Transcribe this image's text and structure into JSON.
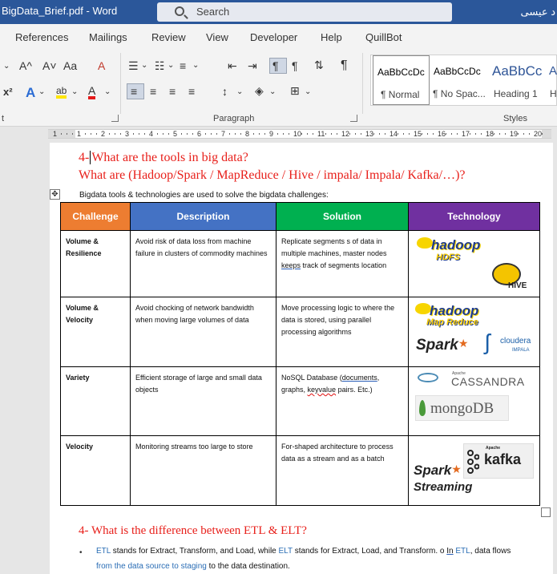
{
  "titlebar": {
    "doc_title": "BigData_Brief.pdf  -  Word",
    "search_label": "Search",
    "user_name": "د عيسى"
  },
  "tabs": [
    "References",
    "Mailings",
    "Review",
    "View",
    "Developer",
    "Help",
    "QuillBot"
  ],
  "ribbon": {
    "font_group_label": "t",
    "paragraph_group_label": "Paragraph",
    "styles_group_label": "Styles",
    "font_buttons": {
      "grow": "A^",
      "shrink": "A˅",
      "case": "Aa",
      "clear": "A",
      "subscript": "x²",
      "text_effects": "A",
      "highlight": "ab",
      "font_color": "A"
    },
    "styles": [
      {
        "preview": "AaBbCcDc",
        "name": "¶ Normal",
        "selected": true
      },
      {
        "preview": "AaBbCcDc",
        "name": "¶ No Spac...",
        "selected": false
      },
      {
        "preview": "AaBbCc",
        "name": "Heading 1",
        "selected": false
      },
      {
        "preview": "A",
        "name": "H",
        "selected": false
      }
    ]
  },
  "ruler": {
    "numbers": [
      "1",
      "1",
      "2",
      "3",
      "4",
      "5",
      "6",
      "7",
      "8",
      "9",
      "10",
      "11",
      "12",
      "13",
      "14",
      "15",
      "16",
      "17",
      "18",
      "19",
      "20"
    ]
  },
  "document": {
    "heading_q4_line1_prefix": "4-",
    "heading_q4_line1": "What are the tools in big data?",
    "heading_q4_line2": "What are (Hadoop/Spark / MapReduce / Hive / impala/ Impala/ Kafka/…)?",
    "intro": "Bigdata tools & technologies are used to solve the bigdata challenges:",
    "table": {
      "headers": [
        {
          "label": "Challenge",
          "color": "#ed7d31"
        },
        {
          "label": "Description",
          "color": "#4472c4"
        },
        {
          "label": "Solution",
          "color": "#00b050"
        },
        {
          "label": "Technology",
          "color": "#7030a0"
        }
      ],
      "rows": [
        {
          "challenge": "Volume & Resilience",
          "description": "Avoid risk of data loss from machine failure in clusters of commodity machines",
          "solution_pre": "Replicate segments s of data in multiple machines, master nodes ",
          "solution_link": "keeps",
          "solution_post": " track of segments location",
          "logos": [
            "hadoop HDFS",
            "HIVE"
          ]
        },
        {
          "challenge": "Volume & Velocity",
          "description": "Avoid chocking of network bandwidth when moving large volumes of data",
          "solution": "Move processing logic to where the data is stored, using parallel processing algorithms",
          "logos": [
            "hadoop Map Reduce",
            "Spark",
            "cloudera IMPALA"
          ]
        },
        {
          "challenge": "Variety",
          "description": "Efficient storage of large and small data objects",
          "solution_pre": "NoSQL Database (",
          "solution_link": "documents",
          "solution_mid": ", graphs, ",
          "solution_err": "keyvalue",
          "solution_post": " pairs. Etc.)",
          "logos": [
            "CASSANDRA",
            "mongoDB"
          ]
        },
        {
          "challenge": "Velocity",
          "description": "Monitoring streams too large to store",
          "solution": "For-shaped architecture to process data as a stream and as a batch",
          "logos": [
            "Spark Streaming",
            "kafka"
          ]
        }
      ]
    },
    "logo_texts": {
      "hadoop": "hadoop",
      "hdfs": "HDFS",
      "hive": "HIVE",
      "mapreduce": "Map Reduce",
      "spark": "Spark",
      "cloudera": "cloudera",
      "impala": "IMPALA",
      "apache": "Apache",
      "cassandra": "CASSANDRA",
      "mongodb": "mongoDB",
      "kafka": "kafka",
      "streaming": "Streaming"
    },
    "heading_q5": "4- What is the difference between ETL & ELT?",
    "bullet": {
      "etl": "ETL",
      "text1": " stands for Extract, Transform, and Load, while ",
      "elt": "ELT",
      "text2": " stands for Extract, Load, and Transform. o ",
      "in_link": "In",
      "text3": " ",
      "etl2": "ETL",
      "text4": ", data flows",
      "line2_blue": "from the data source to staging",
      "line2_rest": " to the data destination."
    }
  }
}
